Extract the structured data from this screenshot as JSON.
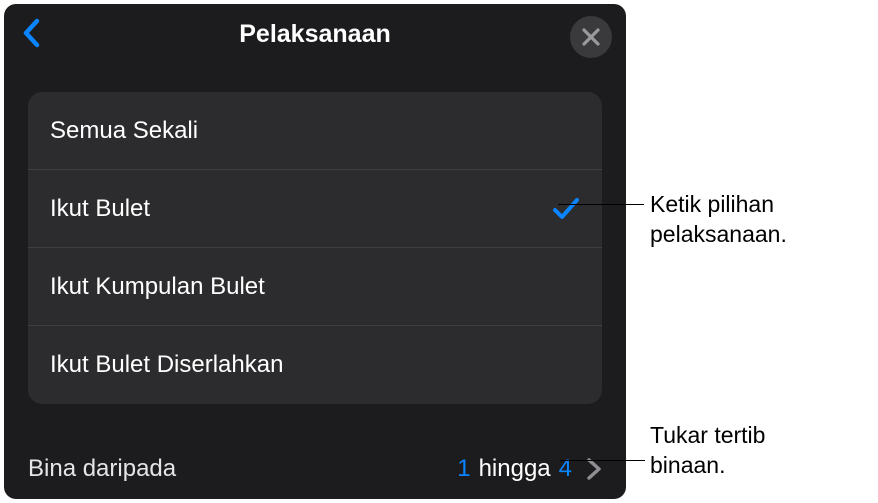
{
  "header": {
    "title": "Pelaksanaan"
  },
  "options": [
    {
      "label": "Semua Sekali",
      "selected": false
    },
    {
      "label": "Ikut Bulet",
      "selected": true
    },
    {
      "label": "Ikut Kumpulan Bulet",
      "selected": false
    },
    {
      "label": "Ikut Bulet Diserlahkan",
      "selected": false
    }
  ],
  "footer": {
    "label": "Bina daripada",
    "from": "1",
    "word": "hingga",
    "to": "4"
  },
  "callouts": {
    "c1_line1": "Ketik pilihan",
    "c1_line2": "pelaksanaan.",
    "c2_line1": "Tukar tertib",
    "c2_line2": "binaan."
  }
}
